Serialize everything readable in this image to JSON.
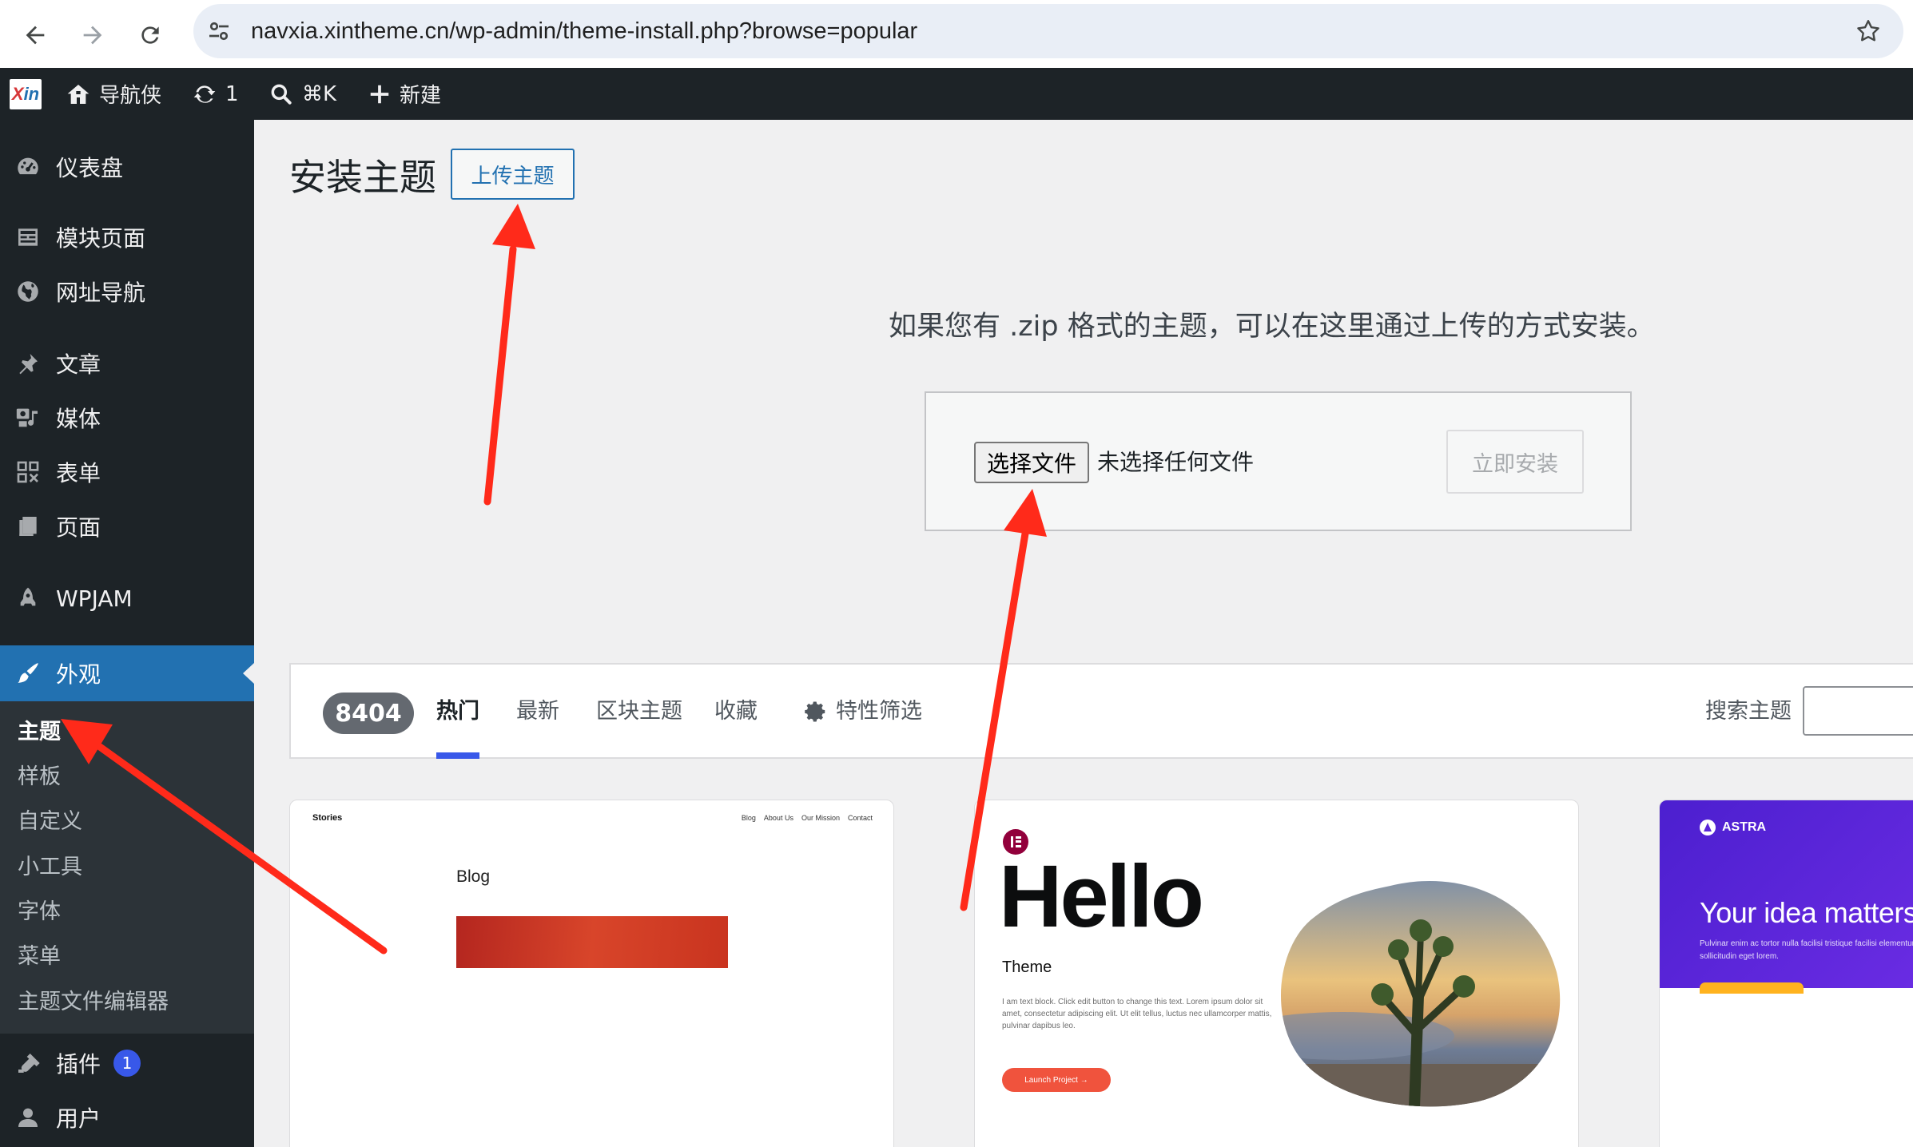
{
  "browser": {
    "url": "navxia.xintheme.cn/wp-admin/theme-install.php?browse=popular",
    "icons": [
      "back-arrow-icon",
      "forward-arrow-icon",
      "reload-icon",
      "site-settings-icon",
      "bookmark-star-icon"
    ]
  },
  "admin_bar": {
    "logo_x": "X",
    "logo_in": "in",
    "site_name": "导航侠",
    "updates_count": "1",
    "search_shortcut": "⌘K",
    "new_label": "新建"
  },
  "sidebar": {
    "items": [
      {
        "label": "仪表盘",
        "icon": "dashboard-icon"
      },
      {
        "label": "模块页面",
        "icon": "block-page-icon"
      },
      {
        "label": "网址导航",
        "icon": "globe-icon"
      },
      {
        "label": "文章",
        "icon": "pin-icon"
      },
      {
        "label": "媒体",
        "icon": "media-icon"
      },
      {
        "label": "表单",
        "icon": "form-icon"
      },
      {
        "label": "页面",
        "icon": "page-icon"
      },
      {
        "label": "WPJAM",
        "icon": "rocket-icon"
      },
      {
        "label": "外观",
        "icon": "appearance-brush-icon"
      },
      {
        "label": "插件",
        "icon": "plugins-icon",
        "badge": "1"
      },
      {
        "label": "用户",
        "icon": "user-icon"
      }
    ],
    "submenu": [
      "主题",
      "样板",
      "自定义",
      "小工具",
      "字体",
      "菜单",
      "主题文件编辑器"
    ]
  },
  "main": {
    "title": "安装主题",
    "upload_button": "上传主题",
    "help_text": "如果您有 .zip 格式的主题，可以在这里通过上传的方式安装。",
    "choose_file": "选择文件",
    "no_file": "未选择任何文件",
    "install_now": "立即安装"
  },
  "filter": {
    "count": "8404",
    "tabs": [
      "热门",
      "最新",
      "区块主题",
      "收藏"
    ],
    "feature_filter": "特性筛选",
    "search_label": "搜索主题",
    "search_value": ""
  },
  "themes": {
    "stories": {
      "site_title": "Stories",
      "nav": [
        "Blog",
        "About Us",
        "Our Mission",
        "Contact"
      ],
      "heading": "Blog"
    },
    "hello": {
      "title": "Hello",
      "subtitle": "Theme",
      "body": "I am text block. Click edit button to change this text. Lorem ipsum dolor sit amet, consectetur adipiscing elit. Ut elit tellus, luctus nec ullamcorper mattis, pulvinar dapibus leo.",
      "button": "Launch Project →"
    },
    "astra": {
      "logo": "ASTRA",
      "title": "Your idea matters",
      "body": "Pulvinar enim ac tortor nulla facilisi tristique facilisi elementum sollicitudin eget lorem."
    }
  },
  "colors": {
    "admin_dark": "#1d2327",
    "accent_blue": "#2271b1",
    "tab_underline": "#3858e9",
    "annotation_red": "#ff2a1a"
  }
}
